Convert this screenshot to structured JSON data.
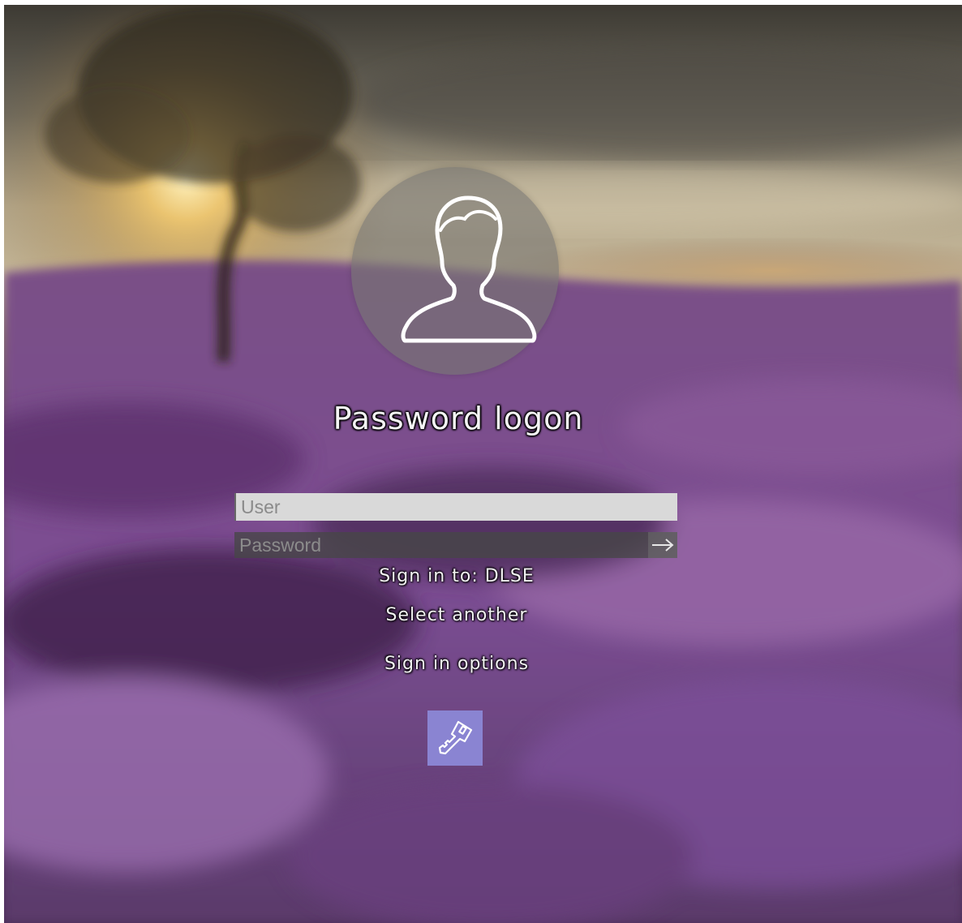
{
  "login": {
    "title": "Password logon",
    "user_placeholder": "User",
    "password_placeholder": "Password",
    "sign_in_to": "Sign in to: DLSE",
    "select_another": "Select another",
    "sign_in_options": "Sign in options"
  },
  "icons": {
    "avatar": "user-silhouette-icon",
    "submit": "arrow-right-icon",
    "option": "key-icon"
  },
  "colors": {
    "key_tile": "#8a84d2",
    "user_field_bg": "#d9d9d9",
    "password_field_bg": "#464646"
  }
}
